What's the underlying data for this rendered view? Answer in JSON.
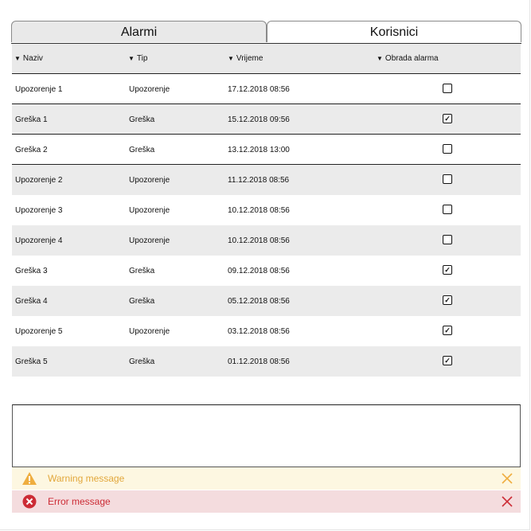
{
  "tabs": [
    {
      "label": "Alarmi",
      "active": false
    },
    {
      "label": "Korisnici",
      "active": true
    }
  ],
  "table": {
    "headers": [
      "Naziv",
      "Tip",
      "Vrijeme",
      "Obrada alarma"
    ],
    "rows": [
      {
        "naziv": "Upozorenje 1",
        "tip": "Upozorenje",
        "vrijeme": "17.12.2018 08:56",
        "obrada": false
      },
      {
        "naziv": "Greška 1",
        "tip": "Greška",
        "vrijeme": "15.12.2018 09:56",
        "obrada": true
      },
      {
        "naziv": "Greška 2",
        "tip": "Greška",
        "vrijeme": "13.12.2018 13:00",
        "obrada": false
      },
      {
        "naziv": "Upozorenje 2",
        "tip": "Upozorenje",
        "vrijeme": "11.12.2018 08:56",
        "obrada": false
      },
      {
        "naziv": "Upozorenje 3",
        "tip": "Upozorenje",
        "vrijeme": "10.12.2018 08:56",
        "obrada": false
      },
      {
        "naziv": "Upozorenje 4",
        "tip": "Upozorenje",
        "vrijeme": "10.12.2018 08:56",
        "obrada": false
      },
      {
        "naziv": "Greška 3",
        "tip": "Greška",
        "vrijeme": "09.12.2018 08:56",
        "obrada": true
      },
      {
        "naziv": "Greška 4",
        "tip": "Greška",
        "vrijeme": "05.12.2018 08:56",
        "obrada": true
      },
      {
        "naziv": "Upozorenje 5",
        "tip": "Upozorenje",
        "vrijeme": "03.12.2018 08:56",
        "obrada": true
      },
      {
        "naziv": "Greška 5",
        "tip": "Greška",
        "vrijeme": "01.12.2018 08:56",
        "obrada": true
      }
    ]
  },
  "messages": {
    "warning": {
      "text": "Warning message",
      "icon": "warning-triangle-icon",
      "color": "#e2a73b"
    },
    "error": {
      "text": "Error message",
      "icon": "error-circle-icon",
      "color": "#cc2b35"
    }
  }
}
